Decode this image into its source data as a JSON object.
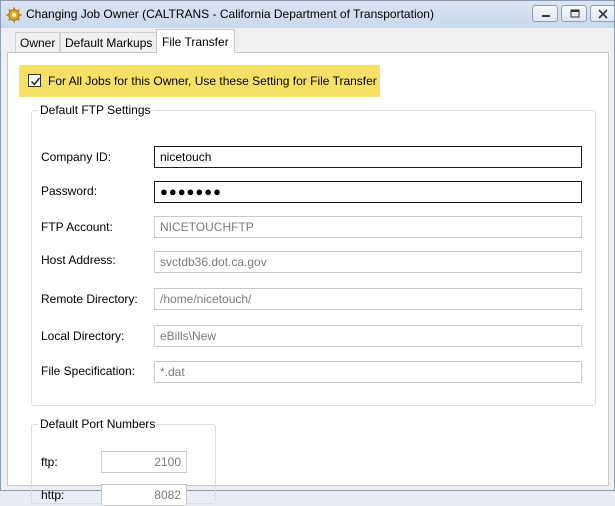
{
  "window": {
    "title": "Changing Job Owner  (CALTRANS - California Department of Transportation)",
    "icon": "gear-icon",
    "controls": [
      "minimize",
      "maximize",
      "close"
    ]
  },
  "tabs": [
    {
      "label": "Owner",
      "active": false
    },
    {
      "label": "Default Markups",
      "active": false
    },
    {
      "label": "File Transfer",
      "active": true
    }
  ],
  "file_transfer": {
    "apply_all": {
      "label": "For All Jobs for this Owner, Use these Setting for File Transfer",
      "checked": true,
      "highlight_color": "#f7e165"
    },
    "ftp_group": {
      "legend": "Default FTP Settings",
      "fields": [
        {
          "label": "Company ID:",
          "value": "nicetouch",
          "enabled": true
        },
        {
          "label": "Password:",
          "value": "●●●●●●●",
          "enabled": true
        },
        {
          "label": "FTP Account:",
          "value": "NICETOUCHFTP",
          "enabled": false
        },
        {
          "label": "Host Address:",
          "value": "svctdb36.dot.ca.gov",
          "enabled": false
        },
        {
          "label": "Remote Directory:",
          "value": "/home/nicetouch/",
          "enabled": false
        },
        {
          "label": "Local Directory:",
          "value": "eBills\\New",
          "enabled": false
        },
        {
          "label": "File Specification:",
          "value": "*.dat",
          "enabled": false
        }
      ]
    },
    "port_group": {
      "legend": "Default Port Numbers",
      "fields": [
        {
          "label": "ftp:",
          "value": "2100",
          "enabled": false
        },
        {
          "label": "http:",
          "value": "8082",
          "enabled": false
        }
      ]
    }
  }
}
